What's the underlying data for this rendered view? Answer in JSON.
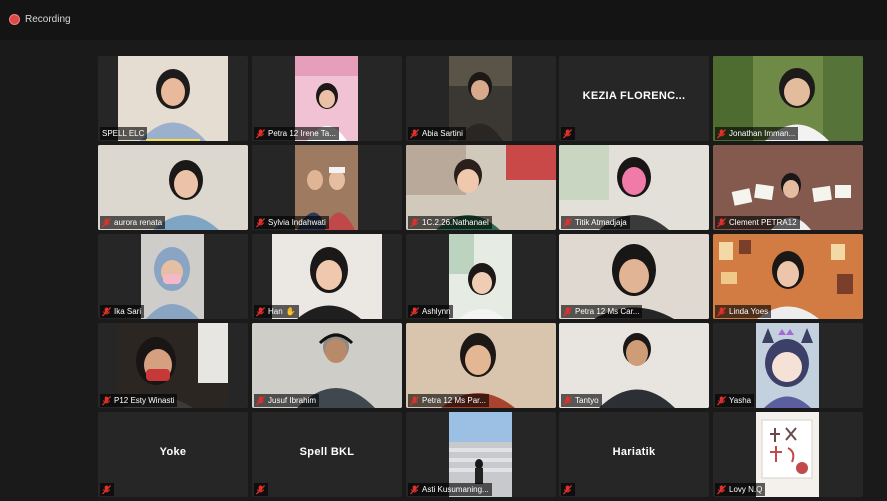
{
  "recording": {
    "label": "Recording"
  },
  "participants": [
    {
      "name": "SPELL ELC",
      "muted": false,
      "video": true
    },
    {
      "name": "Petra 12 Irene Ta...",
      "muted": true,
      "video": true
    },
    {
      "name": "Abia Sartini",
      "muted": true,
      "video": true
    },
    {
      "name": "KEZIA FLORENC...",
      "muted": true,
      "video": false
    },
    {
      "name": "Jonathan Imman...",
      "muted": true,
      "video": true
    },
    {
      "name": "aurora renata",
      "muted": true,
      "video": true
    },
    {
      "name": "Sylvia Indahwati",
      "muted": true,
      "video": true
    },
    {
      "name": "1C.2.26.Nathanael",
      "muted": true,
      "video": true
    },
    {
      "name": "Titik Atmadjaja",
      "muted": true,
      "video": true
    },
    {
      "name": "Clement PETRA12",
      "muted": true,
      "video": true
    },
    {
      "name": "Ika Sari",
      "muted": true,
      "video": true
    },
    {
      "name": "Han",
      "muted": true,
      "video": true
    },
    {
      "name": "Ashlynn",
      "muted": true,
      "video": true
    },
    {
      "name": "Petra 12 Ms Car...",
      "muted": true,
      "video": true
    },
    {
      "name": "Linda Yoes",
      "muted": true,
      "video": true
    },
    {
      "name": "P12 Esty Winasti",
      "muted": true,
      "video": true
    },
    {
      "name": "Jusuf Ibrahim",
      "muted": true,
      "video": true
    },
    {
      "name": "Petra 12 Ms Par...",
      "muted": true,
      "video": true
    },
    {
      "name": "Tantyo",
      "muted": true,
      "video": true
    },
    {
      "name": "Yasha",
      "muted": true,
      "video": true
    },
    {
      "name": "Yoke",
      "muted": true,
      "video": false
    },
    {
      "name": "Spell BKL",
      "muted": true,
      "video": false
    },
    {
      "name": "Asti Kusumaning...",
      "muted": true,
      "video": true
    },
    {
      "name": "Hariatik",
      "muted": true,
      "video": false
    },
    {
      "name": "Lovy N.Q",
      "muted": true,
      "video": true
    }
  ],
  "colors": {
    "muted_icon": "#e0312b",
    "active_speaker": "#f4e04d",
    "tile_bg": "#262626"
  },
  "icons": {
    "muted": "mic-muted-icon",
    "raise_hand": "raise-hand-icon",
    "recording": "recording-dot-icon"
  },
  "reactions": {
    "hand_glyph": "✋"
  }
}
